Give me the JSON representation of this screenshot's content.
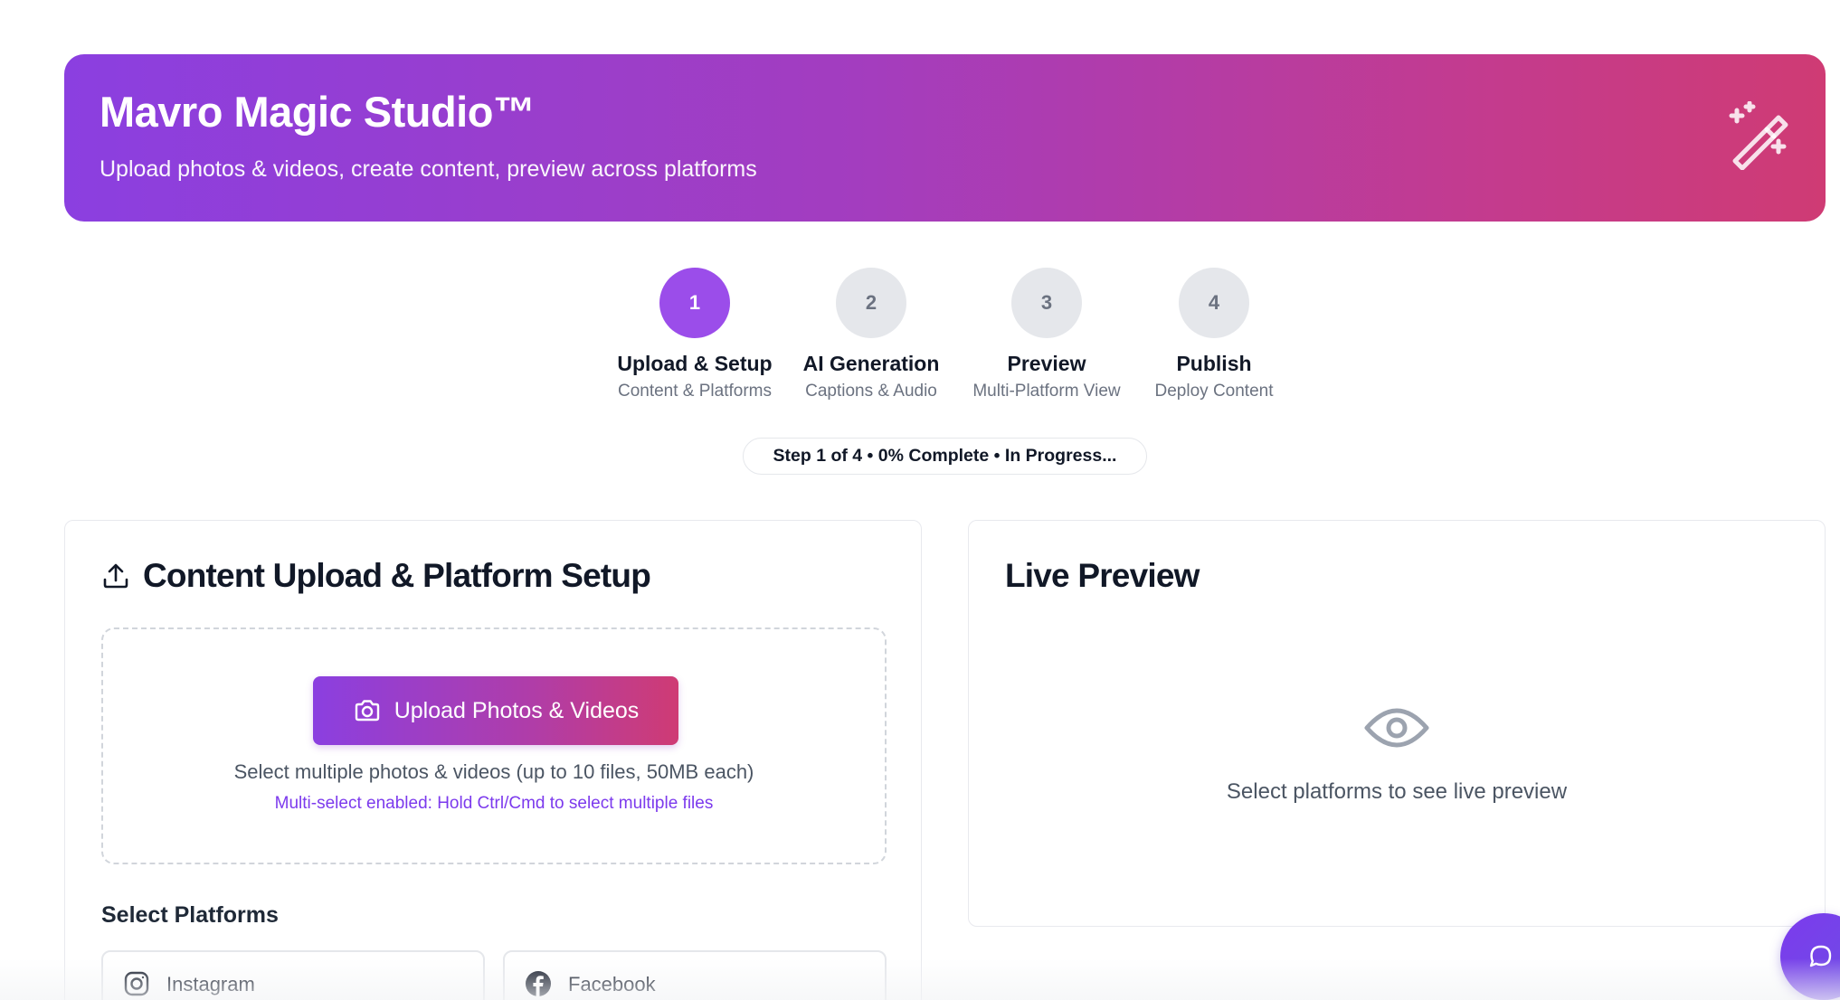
{
  "hero": {
    "title": "Mavro Magic Studio™",
    "subtitle": "Upload photos & videos, create content, preview across platforms",
    "icon": "magic-wand-icon"
  },
  "steps": [
    {
      "number": "1",
      "title": "Upload & Setup",
      "subtitle": "Content & Platforms",
      "active": true
    },
    {
      "number": "2",
      "title": "AI Generation",
      "subtitle": "Captions & Audio",
      "active": false
    },
    {
      "number": "3",
      "title": "Preview",
      "subtitle": "Multi-Platform View",
      "active": false
    },
    {
      "number": "4",
      "title": "Publish",
      "subtitle": "Deploy Content",
      "active": false
    }
  ],
  "progress": {
    "label": "Step 1 of 4 • 0% Complete • In Progress...",
    "current_step": 1,
    "total_steps": 4,
    "percent_complete": 0
  },
  "upload_card": {
    "title": "Content Upload & Platform Setup",
    "icon": "upload-icon",
    "upload_button": "Upload Photos & Videos",
    "hint": "Select multiple photos & videos (up to 10 files, 50MB each)",
    "note": "Multi-select enabled: Hold Ctrl/Cmd to select multiple files",
    "platforms_label": "Select Platforms",
    "platforms": [
      {
        "label": "Instagram",
        "icon": "instagram-icon"
      },
      {
        "label": "Facebook",
        "icon": "facebook-icon"
      }
    ]
  },
  "preview_card": {
    "title": "Live Preview",
    "empty_text": "Select platforms to see live preview",
    "icon": "eye-icon"
  },
  "chat": {
    "icon": "chat-bubble-icon"
  },
  "colors": {
    "accent_purple": "#9b4dea",
    "gradient_start": "#8b3fe0",
    "gradient_end": "#cf3b74",
    "note_purple": "#7c3aed",
    "muted_text": "#6b7280"
  }
}
